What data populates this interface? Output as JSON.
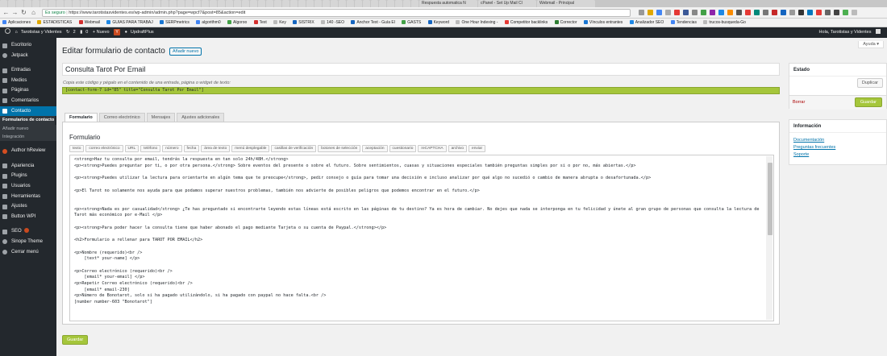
{
  "browser": {
    "tabs": [
      {
        "title": "Respuesta automatica N"
      },
      {
        "title": "cPanel - Set Up Mail Cl"
      },
      {
        "title": "Webmail - Principal"
      }
    ],
    "security_label": "Es seguro",
    "url": "https://www.tarotistasvidentes.es/wp-admin/admin.php?page=wpcf7&post=85&action=edit",
    "bookmarks": [
      "Aplicaciones",
      "ESTADISTICAS",
      "Webmail",
      "GUIAS PARA TRABAJ",
      "SERPmetrics",
      "algorithm0",
      "Algoroo",
      "Text",
      "Key",
      "SISTRIX",
      "140 -SEO",
      "Anchor Text - Guía El",
      "GASTS",
      "Keyword",
      "One Hour Indexing -",
      "Competitor backlinks",
      "Corrector",
      "Vínculos entrantes",
      "Analizador SEO",
      "Tendencias",
      "trucos-busqueda-Go"
    ]
  },
  "adminbar": {
    "site": "Tarotistas y Videntes",
    "updates": "2",
    "comments": "0",
    "new": "+ Nuevo",
    "plugin": "UpdraftPlus",
    "greeting": "Hola, Tarotistas y Videntes"
  },
  "sidebar": {
    "items": [
      {
        "label": "Escritorio"
      },
      {
        "label": "Jetpack"
      },
      {
        "label": "Entradas"
      },
      {
        "label": "Medios"
      },
      {
        "label": "Páginas"
      },
      {
        "label": "Comentarios"
      },
      {
        "label": "Contacto"
      }
    ],
    "sub": [
      "Formularios de contacto",
      "Añadir nuevo",
      "Integración"
    ],
    "items2": [
      {
        "label": "Author hReview"
      },
      {
        "label": "Apariencia"
      },
      {
        "label": "Plugins"
      },
      {
        "label": "Usuarios"
      },
      {
        "label": "Herramientas"
      },
      {
        "label": "Ajustes"
      },
      {
        "label": "Button WPI"
      },
      {
        "label": "SEO"
      },
      {
        "label": "Sinope Theme"
      },
      {
        "label": "Cerrar menú"
      }
    ]
  },
  "main": {
    "help": "Ayuda ▾",
    "title": "Editar formulario de contacto",
    "add_new": "Añadir nuevo",
    "form_title": "Consulta Tarot Por Email",
    "copy_hint": "Copia este código y pégalo en el contenido de una entrada, página o widget de texto:",
    "shortcode": "[contact-form-7 id=\"85\" title=\"Consulta Tarot Por Email\"]",
    "tabs": [
      "Formulario",
      "Correo electrónico",
      "Mensajes",
      "Ajustes adicionales"
    ],
    "panel_title": "Formulario",
    "tag_buttons": [
      "texto",
      "correo electrónico",
      "URL",
      "teléfono",
      "número",
      "fecha",
      "área de texto",
      "menú desplegable",
      "casillas de verificación",
      "botones de selección",
      "aceptación",
      "cuestionario",
      "reCAPTCHA",
      "archivo",
      "enviar"
    ],
    "code_lines": [
      "<strong>Haz tu consulta por email, tendrás la respuesta en tan solo 24h/48H.</strong>",
      "<p><strong>Puedes preguntar por ti, o por otra persona.</strong> Sobre eventos del presente o sobre el futuro. Sobre sentimientos, cuasas y situaciones especiales también preguntas simples por si o por no, más abiertas.</p>",
      "",
      "<p><strong>Puedes utilizar la lectura para orientarte en algún tema que te preocupe</strong>, pedir consejo o guía para tomar una decisión e incluso analizar por qué algo no sucedió o cambio de manera abrupta o desafortunada.</p>",
      "",
      "<p>El Tarot no solamente nos ayuda para que podamos superar nuestros problemas, también nos advierte de posibles peligros que podemos encontrar en el futuro.</p>",
      "",
      "",
      "<p><strong>Nada es por casualidad</strong> ¿Te has preguntado si encontrarte leyendo estas líneas está escrito en las páginas de tu destino? Ya es hora de cambiar. No dejes que nada se interponga en tu felicidad y únete al gran grupo de personas que consulta la lectura de Tarot más económico por e-Mail </p>",
      "",
      "<p><strong>Para poder hacer la consulta tiene que haber abonado el pago mediante Tarjeta o su cuenta de Paypal.</strong></p>",
      "",
      "<h2>Formulario a rellenar para TAROT POR EMAIL</h2>",
      "",
      "<p>Nombre (requerido)<br />",
      "    [text* your-name] </p>",
      "",
      "<p>Correo electrónico (requerido)<br />",
      "    [email* your-email] </p>",
      "<p>Repetir Correo electrónico (requerido)<br />",
      "    [email* email-230]",
      "<p>Número de Bonotarot, solo si ha pagado utilizándolo, si ha pagado con paypal no hace falta.<br />",
      "[number number-603 \"Bonotarot\"]"
    ],
    "save": "Guardar"
  },
  "status_box": {
    "title": "Estado",
    "duplicate": "Duplicar",
    "delete": "Borrar",
    "save": "Guardar"
  },
  "info_box": {
    "title": "Información",
    "links": [
      "Documentación",
      "Preguntas frecuentes",
      "Soporte"
    ]
  }
}
